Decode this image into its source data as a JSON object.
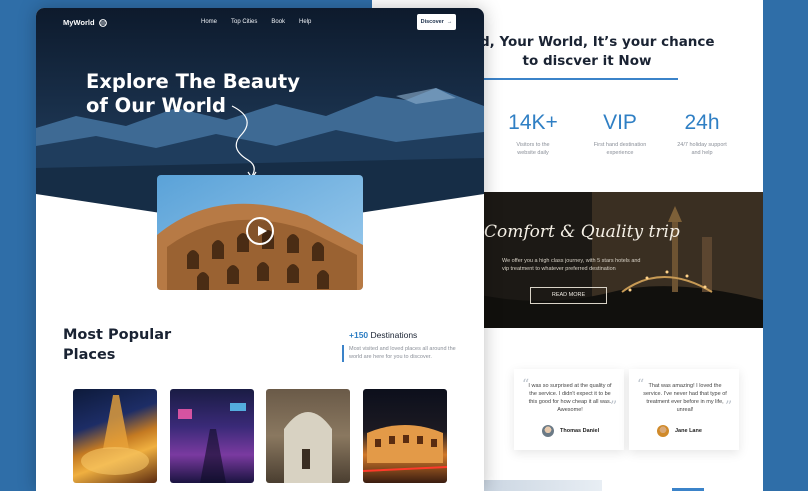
{
  "nav": {
    "logo": "MyWorld",
    "links": [
      "Home",
      "Top Cities",
      "Book",
      "Help"
    ],
    "discover_label": "Discover"
  },
  "hero": {
    "title_line1": "Explore The Beauty",
    "title_line2": "of Our World"
  },
  "popular": {
    "title_line1": "Most Popular",
    "title_line2": "Places",
    "count": "+150",
    "count_label": "Destinations",
    "description": "Most visited and loved places all around the world are here for you to discover."
  },
  "places": [
    {
      "name": "Eiffel Tower carousel"
    },
    {
      "name": "Neon street"
    },
    {
      "name": "Old town archway"
    },
    {
      "name": "Colosseum at night"
    }
  ],
  "second_page": {
    "headline_line1": "orld, Your World, It’s your chance",
    "headline_line2": "to discver it Now",
    "stats": [
      {
        "value": "14K+",
        "label_line1": "Visitors to the",
        "label_line2": "website daily"
      },
      {
        "value": "VIP",
        "label_line1": "First hand destination",
        "label_line2": "experience"
      },
      {
        "value": "24h",
        "label_line1": "24/7 holiday support",
        "label_line2": "and help"
      }
    ],
    "comfort": {
      "title": "Comfort & Quality trip",
      "text": "We offer you a high class journey, with 5 stars hotels and vip treatment to whatever preferred destination",
      "button": "READ MORE"
    },
    "testimonials": [
      {
        "quote": "I was so surprised at the quality of the service. I didn't expect it to be this good for how cheap it all was. Awesome!",
        "name": "Thomas Daniel"
      },
      {
        "quote": "That was amazing! I loved the service. I've never had that type of treatment ever before in my life, unreal!",
        "name": "Jane Lane"
      }
    ],
    "partial_card_lines": [
      "re",
      "e"
    ]
  },
  "colors": {
    "background": "#2f6ea8",
    "accent": "#2f7fc4",
    "dark_text": "#1a2333"
  }
}
